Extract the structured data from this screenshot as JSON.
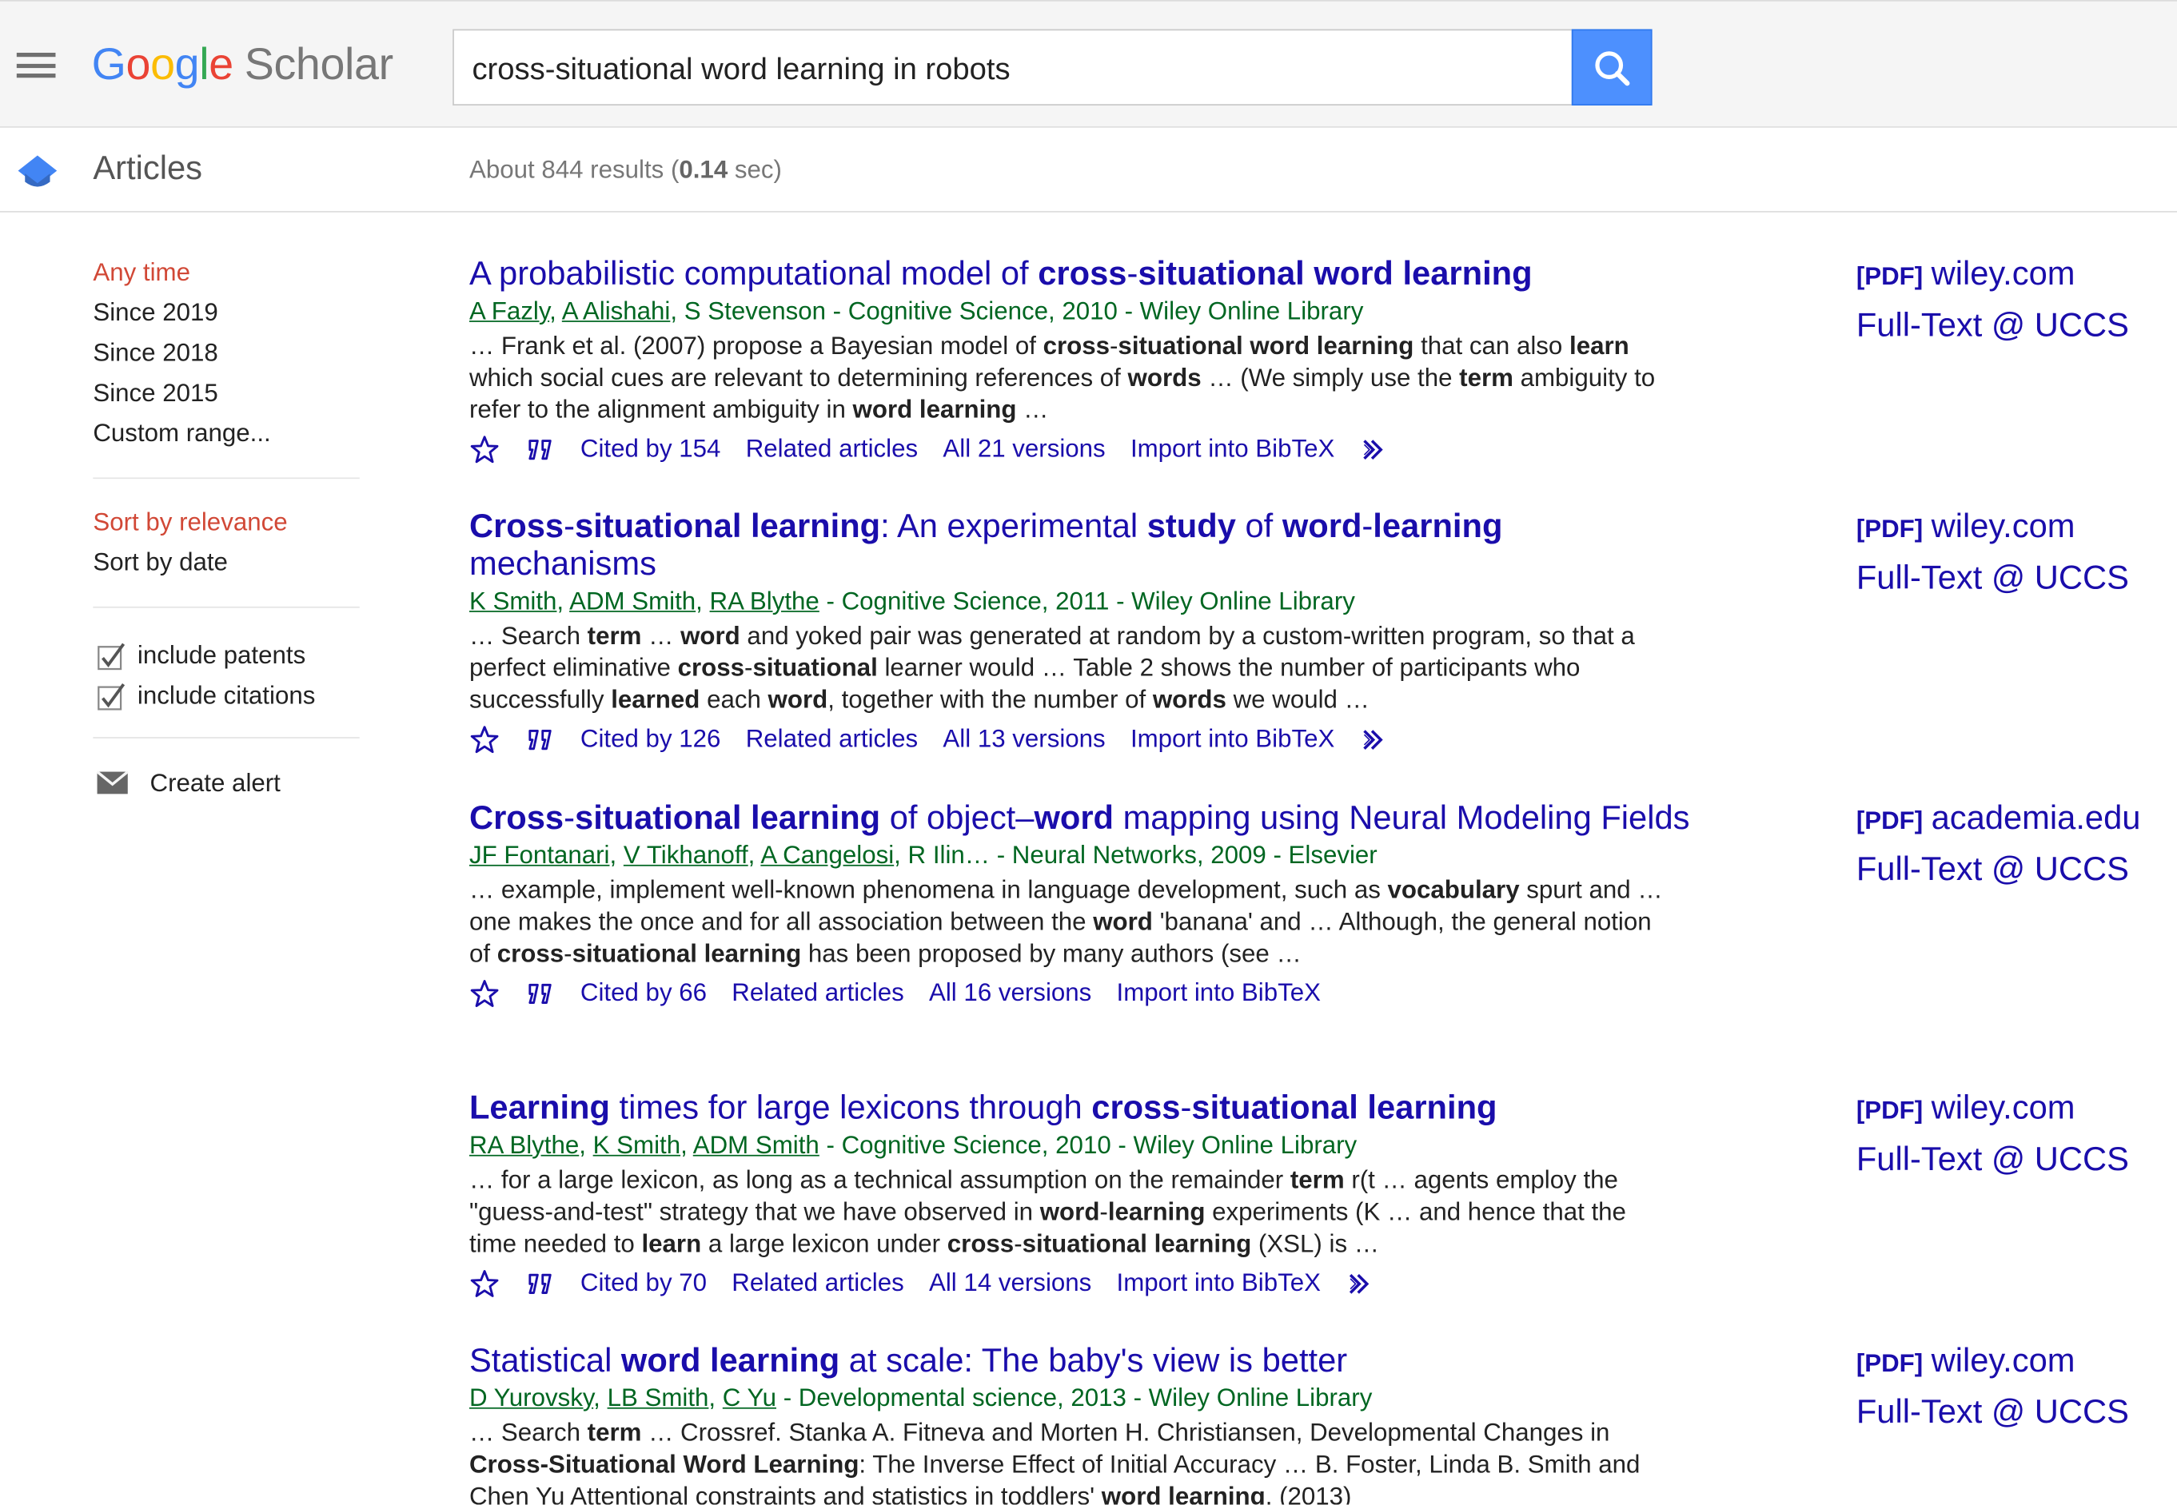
{
  "header": {
    "logo": {
      "google": [
        "G",
        "o",
        "o",
        "g",
        "l",
        "e"
      ],
      "scholar": "Scholar"
    },
    "search_value": "cross-situational word learning in robots",
    "colors": {
      "logo_blue": "#4285f4",
      "logo_red": "#ea4335",
      "logo_yellow": "#fbbc05",
      "logo_green": "#34a853",
      "search_button": "#4d90fe"
    },
    "icons": {
      "menu": "hamburger-icon",
      "search": "search-icon",
      "scholar_cap": "mortarboard-icon"
    }
  },
  "subheader": {
    "section": "Articles",
    "stats_prefix": "About 844 results (",
    "stats_time": "0.14",
    "stats_suffix": " sec)"
  },
  "sidebar": {
    "time_filters": [
      "Any time",
      "Since 2019",
      "Since 2018",
      "Since 2015",
      "Custom range..."
    ],
    "sort_options": [
      "Sort by relevance",
      "Sort by date"
    ],
    "checkboxes": [
      "include patents",
      "include citations"
    ],
    "checkbox_states": [
      true,
      true
    ],
    "alert": "Create alert",
    "active_color": "#d14836"
  },
  "results": [
    {
      "title": [
        [
          "A probabilistic computational model of ",
          false
        ],
        [
          "cross",
          true
        ],
        [
          "-",
          false
        ],
        [
          "situational word learning",
          true
        ]
      ],
      "authors": [
        [
          "A Fazly",
          true
        ],
        [
          ", ",
          false
        ],
        [
          "A Alishahi",
          true
        ],
        [
          ", S Stevenson - Cognitive Science, 2010 - Wiley Online Library",
          false
        ]
      ],
      "snippet": [
        [
          "… Frank et al. (2007) propose a Bayesian model of ",
          false
        ],
        [
          "cross",
          true
        ],
        [
          "-",
          false
        ],
        [
          "situational word learning",
          true
        ],
        [
          " that can also ",
          false
        ],
        [
          "learn",
          true
        ],
        [
          " which social cues are relevant to determining references of ",
          false
        ],
        [
          "words",
          true
        ],
        [
          " … (We simply use the ",
          false
        ],
        [
          "term",
          true
        ],
        [
          " ambiguity to refer to the alignment ambiguity in ",
          false
        ],
        [
          "word learning",
          true
        ],
        [
          " …",
          false
        ]
      ],
      "cited": "Cited by 154",
      "related": "Related articles",
      "versions": "All 21 versions",
      "import": "Import into BibTeX",
      "more": true,
      "pdf_tag": "[PDF]",
      "pdf_source": "wiley.com",
      "fulltext": "Full-Text @ UCCS"
    },
    {
      "title": [
        [
          "Cross",
          true
        ],
        [
          "-",
          false
        ],
        [
          "situational learning",
          true
        ],
        [
          ": An experimental ",
          false
        ],
        [
          "study",
          true
        ],
        [
          " of ",
          false
        ],
        [
          "word",
          true
        ],
        [
          "-",
          false
        ],
        [
          "learning",
          true
        ],
        [
          " mechanisms",
          false
        ]
      ],
      "authors": [
        [
          "K Smith",
          true
        ],
        [
          ", ",
          false
        ],
        [
          "ADM Smith",
          true
        ],
        [
          ", ",
          false
        ],
        [
          "RA Blythe",
          true
        ],
        [
          " - Cognitive Science, 2011 - Wiley Online Library",
          false
        ]
      ],
      "snippet": [
        [
          "… Search ",
          false
        ],
        [
          "term",
          true
        ],
        [
          " … ",
          false
        ],
        [
          "word",
          true
        ],
        [
          " and yoked pair was generated at random by a custom-written program, so that a perfect eliminative ",
          false
        ],
        [
          "cross",
          true
        ],
        [
          "-",
          false
        ],
        [
          "situational",
          true
        ],
        [
          " learner would … Table 2 shows the number of participants who successfully ",
          false
        ],
        [
          "learned",
          true
        ],
        [
          " each ",
          false
        ],
        [
          "word",
          true
        ],
        [
          ", together with the number of ",
          false
        ],
        [
          "words",
          true
        ],
        [
          " we would …",
          false
        ]
      ],
      "cited": "Cited by 126",
      "related": "Related articles",
      "versions": "All 13 versions",
      "import": "Import into BibTeX",
      "more": true,
      "pdf_tag": "[PDF]",
      "pdf_source": "wiley.com",
      "fulltext": "Full-Text @ UCCS"
    },
    {
      "title": [
        [
          "Cross",
          true
        ],
        [
          "-",
          false
        ],
        [
          "situational learning",
          true
        ],
        [
          " of object–",
          false
        ],
        [
          "word",
          true
        ],
        [
          " mapping using Neural Modeling Fields",
          false
        ]
      ],
      "authors": [
        [
          "JF Fontanari",
          true
        ],
        [
          ", ",
          false
        ],
        [
          "V Tikhanoff",
          true
        ],
        [
          ", ",
          false
        ],
        [
          "A Cangelosi",
          true
        ],
        [
          ", R Ilin… - Neural Networks, 2009 - Elsevier",
          false
        ]
      ],
      "snippet": [
        [
          "… example, implement well-known phenomena in language development, such as ",
          false
        ],
        [
          "vocabulary",
          true
        ],
        [
          " spurt and … one makes the once and for all association between the ",
          false
        ],
        [
          "word",
          true
        ],
        [
          " 'banana' and … Although, the general notion of ",
          false
        ],
        [
          "cross",
          true
        ],
        [
          "-",
          false
        ],
        [
          "situational learning",
          true
        ],
        [
          " has been proposed by many authors (see …",
          false
        ]
      ],
      "cited": "Cited by 66",
      "related": "Related articles",
      "versions": "All 16 versions",
      "import": "Import into BibTeX",
      "more": false,
      "pdf_tag": "[PDF]",
      "pdf_source": "academia.edu",
      "fulltext": "Full-Text @ UCCS"
    },
    {
      "title": [
        [
          "Learning",
          true
        ],
        [
          " times for large lexicons through ",
          false
        ],
        [
          "cross",
          true
        ],
        [
          "-",
          false
        ],
        [
          "situational learning",
          true
        ]
      ],
      "authors": [
        [
          "RA Blythe",
          true
        ],
        [
          ", ",
          false
        ],
        [
          "K Smith",
          true
        ],
        [
          ", ",
          false
        ],
        [
          "ADM Smith",
          true
        ],
        [
          " - Cognitive Science, 2010 - Wiley Online Library",
          false
        ]
      ],
      "snippet": [
        [
          "… for a large lexicon, as long as a technical assumption on the remainder ",
          false
        ],
        [
          "term",
          true
        ],
        [
          " r(t … agents employ the \"guess-and-test\" strategy that we have observed in ",
          false
        ],
        [
          "word",
          true
        ],
        [
          "-",
          false
        ],
        [
          "learning",
          true
        ],
        [
          " experiments (K … and hence that the time needed to ",
          false
        ],
        [
          "learn",
          true
        ],
        [
          " a large lexicon under ",
          false
        ],
        [
          "cross",
          true
        ],
        [
          "-",
          false
        ],
        [
          "situational learning",
          true
        ],
        [
          " (XSL) is …",
          false
        ]
      ],
      "cited": "Cited by 70",
      "related": "Related articles",
      "versions": "All 14 versions",
      "import": "Import into BibTeX",
      "more": true,
      "pdf_tag": "[PDF]",
      "pdf_source": "wiley.com",
      "fulltext": "Full-Text @ UCCS"
    },
    {
      "title": [
        [
          "Statistical ",
          false
        ],
        [
          "word learning",
          true
        ],
        [
          " at scale: The baby's view is better",
          false
        ]
      ],
      "authors": [
        [
          "D Yurovsky",
          true
        ],
        [
          ", ",
          false
        ],
        [
          "LB Smith",
          true
        ],
        [
          ", ",
          false
        ],
        [
          "C Yu",
          true
        ],
        [
          " - Developmental science, 2013 - Wiley Online Library",
          false
        ]
      ],
      "snippet": [
        [
          "… Search ",
          false
        ],
        [
          "term",
          true
        ],
        [
          " … Crossref. Stanka A. Fitneva and Morten H. Christiansen, Developmental Changes in ",
          false
        ],
        [
          "Cross-Situational Word Learning",
          true
        ],
        [
          ": The Inverse Effect of Initial Accuracy … B. Foster, Linda B. Smith and Chen Yu Attentional constraints and statistics in toddlers' ",
          false
        ],
        [
          "word learning",
          true
        ],
        [
          ". (2013)",
          false
        ]
      ],
      "cited": "",
      "related": "",
      "versions": "",
      "import": "",
      "more": false,
      "pdf_tag": "[PDF]",
      "pdf_source": "wiley.com",
      "fulltext": "Full-Text @ UCCS"
    }
  ]
}
